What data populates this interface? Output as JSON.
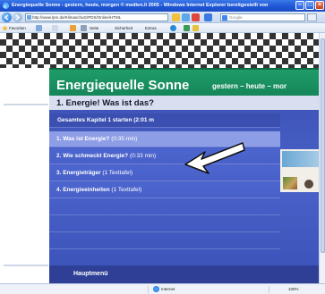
{
  "browser": {
    "title": "Energiequelle Sonne - gestern, heute, morgen © medien.li 2005 - Windows Internet Explorer bereitgestellt von",
    "address": "http://www.lpm.de/Klimaschutz/PDS/Online/HTML",
    "search_placeholder": "Google",
    "favorites_label": "Favoriten",
    "commands": [
      "Seite",
      "Sicherheit",
      "Extras"
    ],
    "status_zone": "Internet",
    "zoom": "100%"
  },
  "site": {
    "brand_title": "Energiequelle Sonne",
    "brand_subtitle": "gestern – heute – mor",
    "chapter_title": "1. Energie! Was ist das?",
    "full_chapter": {
      "label": "Gesamtes Kapitel 1 starten",
      "meta": "(2:01 m"
    },
    "menu_items": [
      {
        "label": "1. Was ist Energie?",
        "meta": "(0:35 min)"
      },
      {
        "label": "2. Wie schmeckt Energie?",
        "meta": "(0:33 min)"
      },
      {
        "label": "3. Energieträger",
        "meta": "(1 Texttafel)"
      },
      {
        "label": "4. Energieeinheiten",
        "meta": "(1 Texttafel)"
      }
    ],
    "home_label": "Hauptmenü"
  }
}
